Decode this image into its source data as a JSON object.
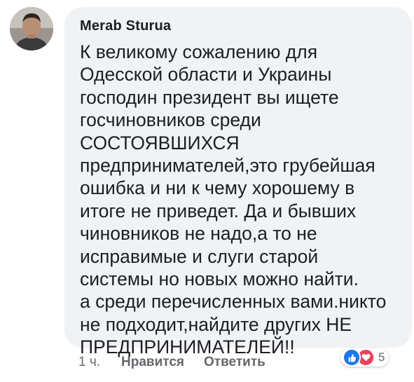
{
  "comment": {
    "author": "Merab Sturua",
    "lines": [
      "К великому сожалению для",
      "Одесской области и Украины",
      "господин президент вы ищете",
      "госчиновников среди",
      "СОСТОЯВШИХСЯ",
      "предпринимателей,это грубейшая",
      "ошибка и ни к чему хорошему в",
      "итоге не приведет. Да и бывших",
      "чиновников не надо,а то не",
      "исправимые и слуги старой",
      "системы но новых можно найти.",
      "а среди перечисленных вами.никто",
      "не подходит,найдите других НЕ",
      "ПРЕДПРИНИМАТЕЛЕЙ!!"
    ],
    "timestamp": "1 ч.",
    "like_label": "Нравится",
    "reply_label": "Ответить",
    "reaction_count": "5",
    "reaction_icons": [
      "like-icon",
      "love-icon"
    ]
  },
  "colors": {
    "bubble": "#f0f2f5",
    "text": "#1c1e21",
    "meta": "#65676b",
    "like": "#1877f2",
    "love": "#f33e58"
  }
}
